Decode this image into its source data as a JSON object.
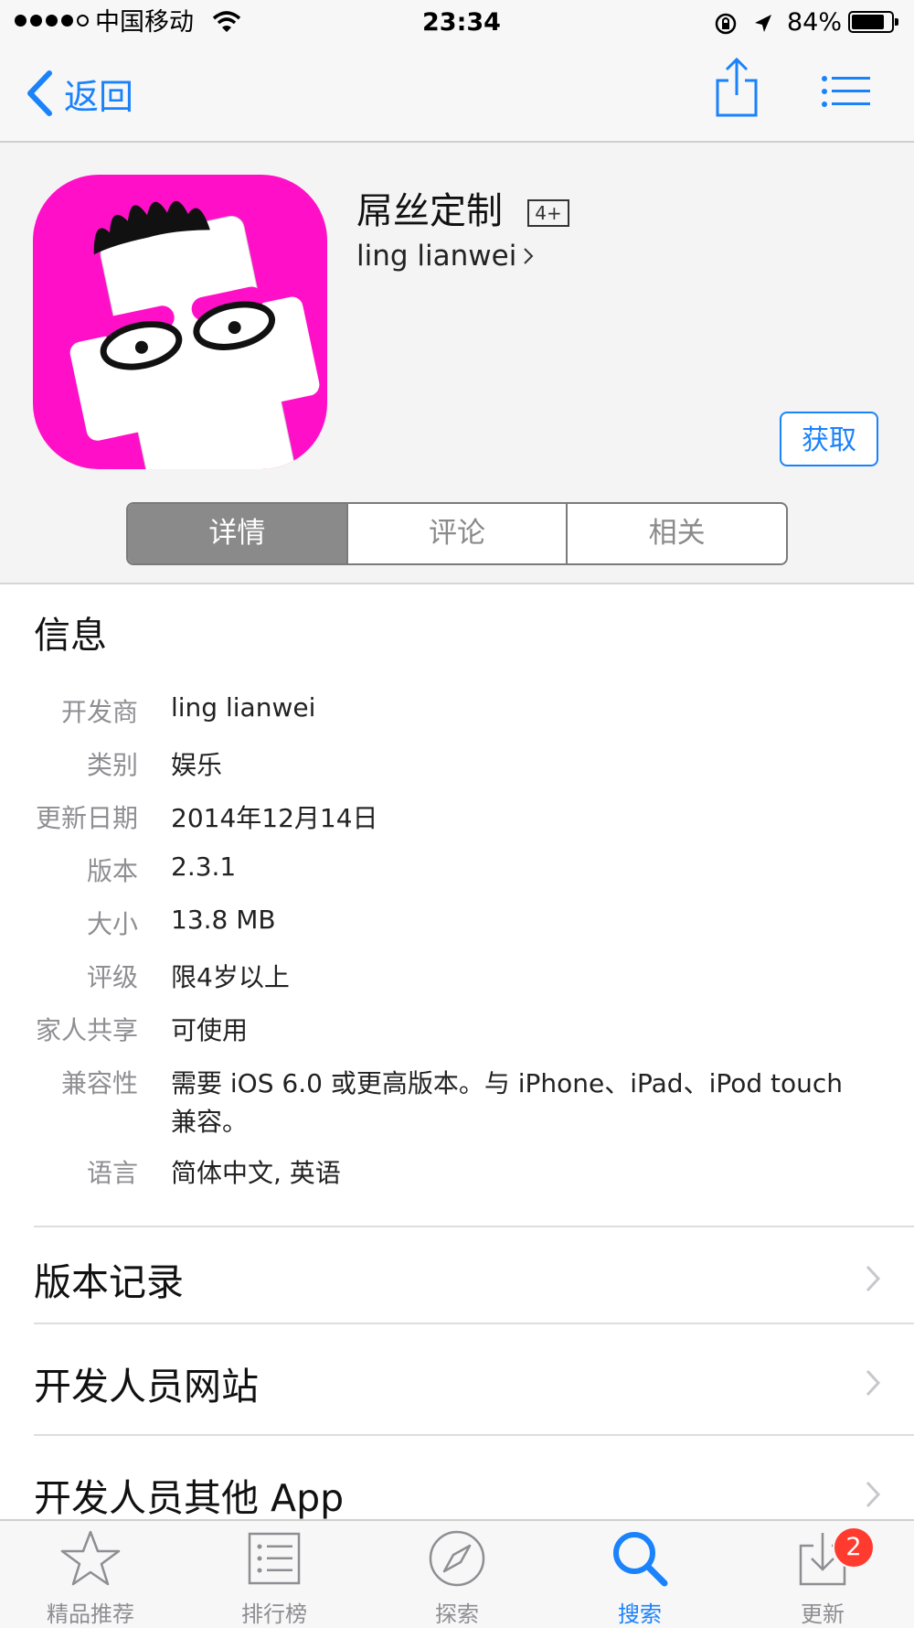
{
  "status_bar": {
    "carrier": "中国移动",
    "time": "23:34",
    "battery": "84%",
    "battery_level": 0.84
  },
  "nav": {
    "back_label": "返回"
  },
  "app": {
    "name": "屌丝定制",
    "age_rating": "4+",
    "developer": "ling lianwei",
    "get_label": "获取"
  },
  "segments": [
    {
      "label": "详情",
      "active": true
    },
    {
      "label": "评论",
      "active": false
    },
    {
      "label": "相关",
      "active": false
    }
  ],
  "info": {
    "title": "信息",
    "rows": [
      {
        "label": "开发商",
        "value": "ling lianwei"
      },
      {
        "label": "类别",
        "value": "娱乐"
      },
      {
        "label": "更新日期",
        "value": "2014年12月14日"
      },
      {
        "label": "版本",
        "value": "2.3.1"
      },
      {
        "label": "大小",
        "value": "13.8 MB"
      },
      {
        "label": "评级",
        "value": "限4岁以上"
      },
      {
        "label": "家人共享",
        "value": "可使用"
      },
      {
        "label": "兼容性",
        "value_line1": "需要 iOS 6.0 或更高版本。与 iPhone、iPad、iPod touch",
        "value_line2": "兼容。"
      },
      {
        "label": "语言",
        "value": "简体中文, 英语"
      }
    ]
  },
  "links": [
    {
      "label": "版本记录"
    },
    {
      "label": "开发人员网站"
    },
    {
      "label": "开发人员其他 App"
    }
  ],
  "tabbar": {
    "tabs": [
      {
        "label": "精品推荐",
        "icon": "star-icon"
      },
      {
        "label": "排行榜",
        "icon": "list-icon"
      },
      {
        "label": "探索",
        "icon": "compass-icon"
      },
      {
        "label": "搜索",
        "icon": "search-icon",
        "active": true
      },
      {
        "label": "更新",
        "icon": "download-icon"
      }
    ],
    "update_badge": "2"
  },
  "colors": {
    "accent": "#1a82fb",
    "icon_bg": "#ff10c8",
    "badge": "#ff3b30"
  }
}
